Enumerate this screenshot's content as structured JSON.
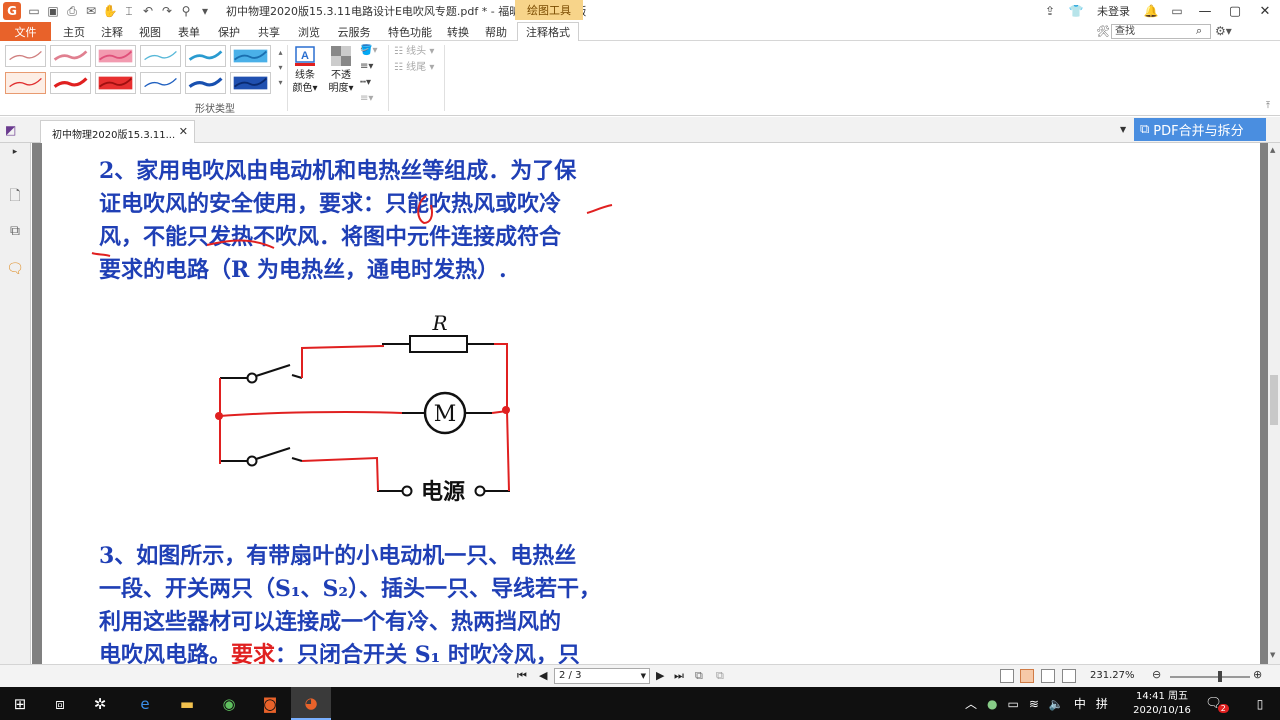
{
  "titlebar": {
    "logo_letter": "G",
    "document_title": "初中物理2020版15.3.11电路设计E电吹风专题.pdf * - 福昕阅读器领鲜版",
    "context_tab": "绘图工具",
    "login": "未登录"
  },
  "menu": {
    "file": "文件",
    "items": [
      "主页",
      "注释",
      "视图",
      "表单",
      "保护",
      "共享",
      "浏览",
      "云服务",
      "特色功能",
      "转换",
      "帮助",
      "注释格式"
    ],
    "active": "注释格式",
    "search_value": "查找"
  },
  "ribbon": {
    "shape_group_label": "形状类型",
    "line_color_label_1": "线条",
    "line_color_label_2": "颜色▾",
    "opacity_label_1": "不透",
    "opacity_label_2": "明度▾",
    "line_start": "线头",
    "line_end": "线尾"
  },
  "tabs": {
    "doc_tab": "初中物理2020版15.3.11...",
    "pdf_merge": "PDF合并与拆分"
  },
  "document": {
    "q2_line1": "2、家用电吹风由电动机和电热丝等组成．为了保",
    "q2_line2": "证电吹风的安全使用，要求：只能吹热风或吹冷",
    "q2_line3": "风，不能只发热不吹风．将图中元件连接成符合",
    "q2_line4": "要求的电路（R 为电热丝，通电时发热）.",
    "circuit_resistor_label": "R",
    "circuit_motor_label": "M",
    "circuit_power_label": "电源",
    "q3_line1": "3、如图所示，有带扇叶的小电动机一只、电热丝",
    "q3_line2": "一段、开关两只（S₁、S₂）、插头一只、导线若干，",
    "q3_line3": "利用这些器材可以连接成一个有冷、热两挡风的",
    "q3_line4_a": "电吹风电路。",
    "q3_line4_red": "要求",
    "q3_line4_b": "：只闭合开关 S₁ 时吹冷风，只"
  },
  "statusbar": {
    "page": "2 / 3",
    "zoom": "231.27%"
  },
  "taskbar": {
    "ime_lang": "中",
    "ime_mode": "拼",
    "time": "14:41 周五",
    "date": "2020/10/16",
    "notif_count": "2"
  }
}
